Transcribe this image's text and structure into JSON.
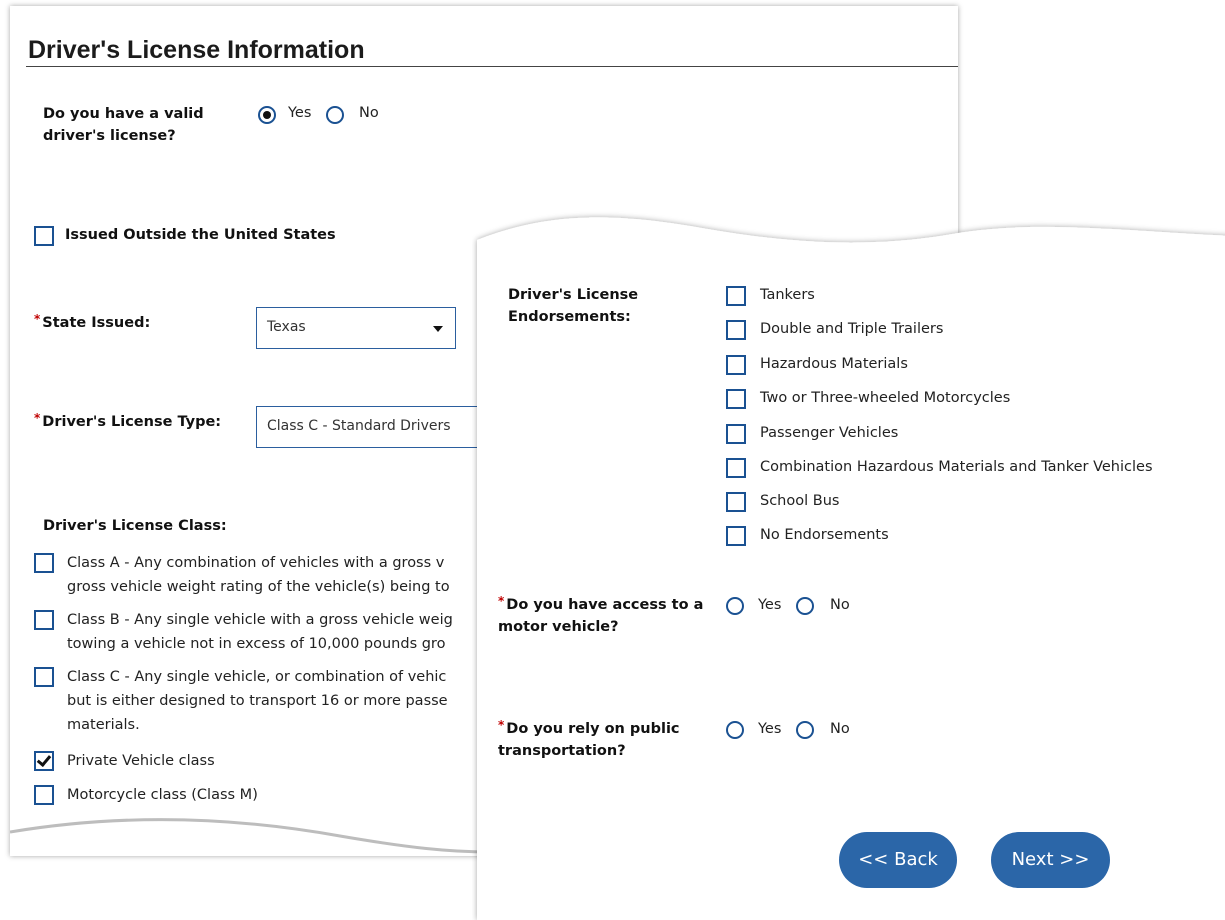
{
  "title": "Driver's License Information",
  "valid_license": {
    "question": "Do you have a valid driver's license?",
    "yes": "Yes",
    "no": "No",
    "selected": "Yes"
  },
  "issued_outside": {
    "label": "Issued Outside the United States",
    "checked": false
  },
  "state_issued": {
    "required_mark": "*",
    "label": "State Issued:",
    "value": "Texas"
  },
  "license_type": {
    "required_mark": "*",
    "label": "Driver's License Type:",
    "value": "Class C - Standard Drivers"
  },
  "license_class": {
    "label": "Driver's License Class:",
    "options": [
      {
        "lines": [
          "Class A - Any combination of vehicles with a gross v",
          "gross vehicle weight rating of the vehicle(s) being to"
        ],
        "checked": false
      },
      {
        "lines": [
          "Class B - Any single vehicle with a gross vehicle weig",
          "towing a vehicle not in excess of 10,000 pounds gro"
        ],
        "checked": false
      },
      {
        "lines": [
          "Class C - Any single vehicle, or combination of vehic",
          "but is either designed to transport 16 or more passe",
          "materials."
        ],
        "checked": false
      },
      {
        "lines": [
          "Private Vehicle class"
        ],
        "checked": true
      },
      {
        "lines": [
          "Motorcycle class (Class M)"
        ],
        "checked": false
      }
    ]
  },
  "endorsements": {
    "label": "Driver's License Endorsements:",
    "options": [
      "Tankers",
      "Double and Triple Trailers",
      "Hazardous Materials",
      "Two or Three-wheeled Motorcycles",
      "Passenger Vehicles",
      "Combination Hazardous Materials and Tanker Vehicles",
      "School Bus",
      "No Endorsements"
    ]
  },
  "motor_vehicle": {
    "required_mark": "*",
    "question": "Do you have access to a motor vehicle?",
    "yes": "Yes",
    "no": "No"
  },
  "public_transport": {
    "required_mark": "*",
    "question": "Do you rely on public transportation?",
    "yes": "Yes",
    "no": "No"
  },
  "buttons": {
    "back": "<< Back",
    "next": "Next >>"
  },
  "colors": {
    "accent": "#1a5192",
    "button": "#2b66a8",
    "required": "#c00000"
  }
}
